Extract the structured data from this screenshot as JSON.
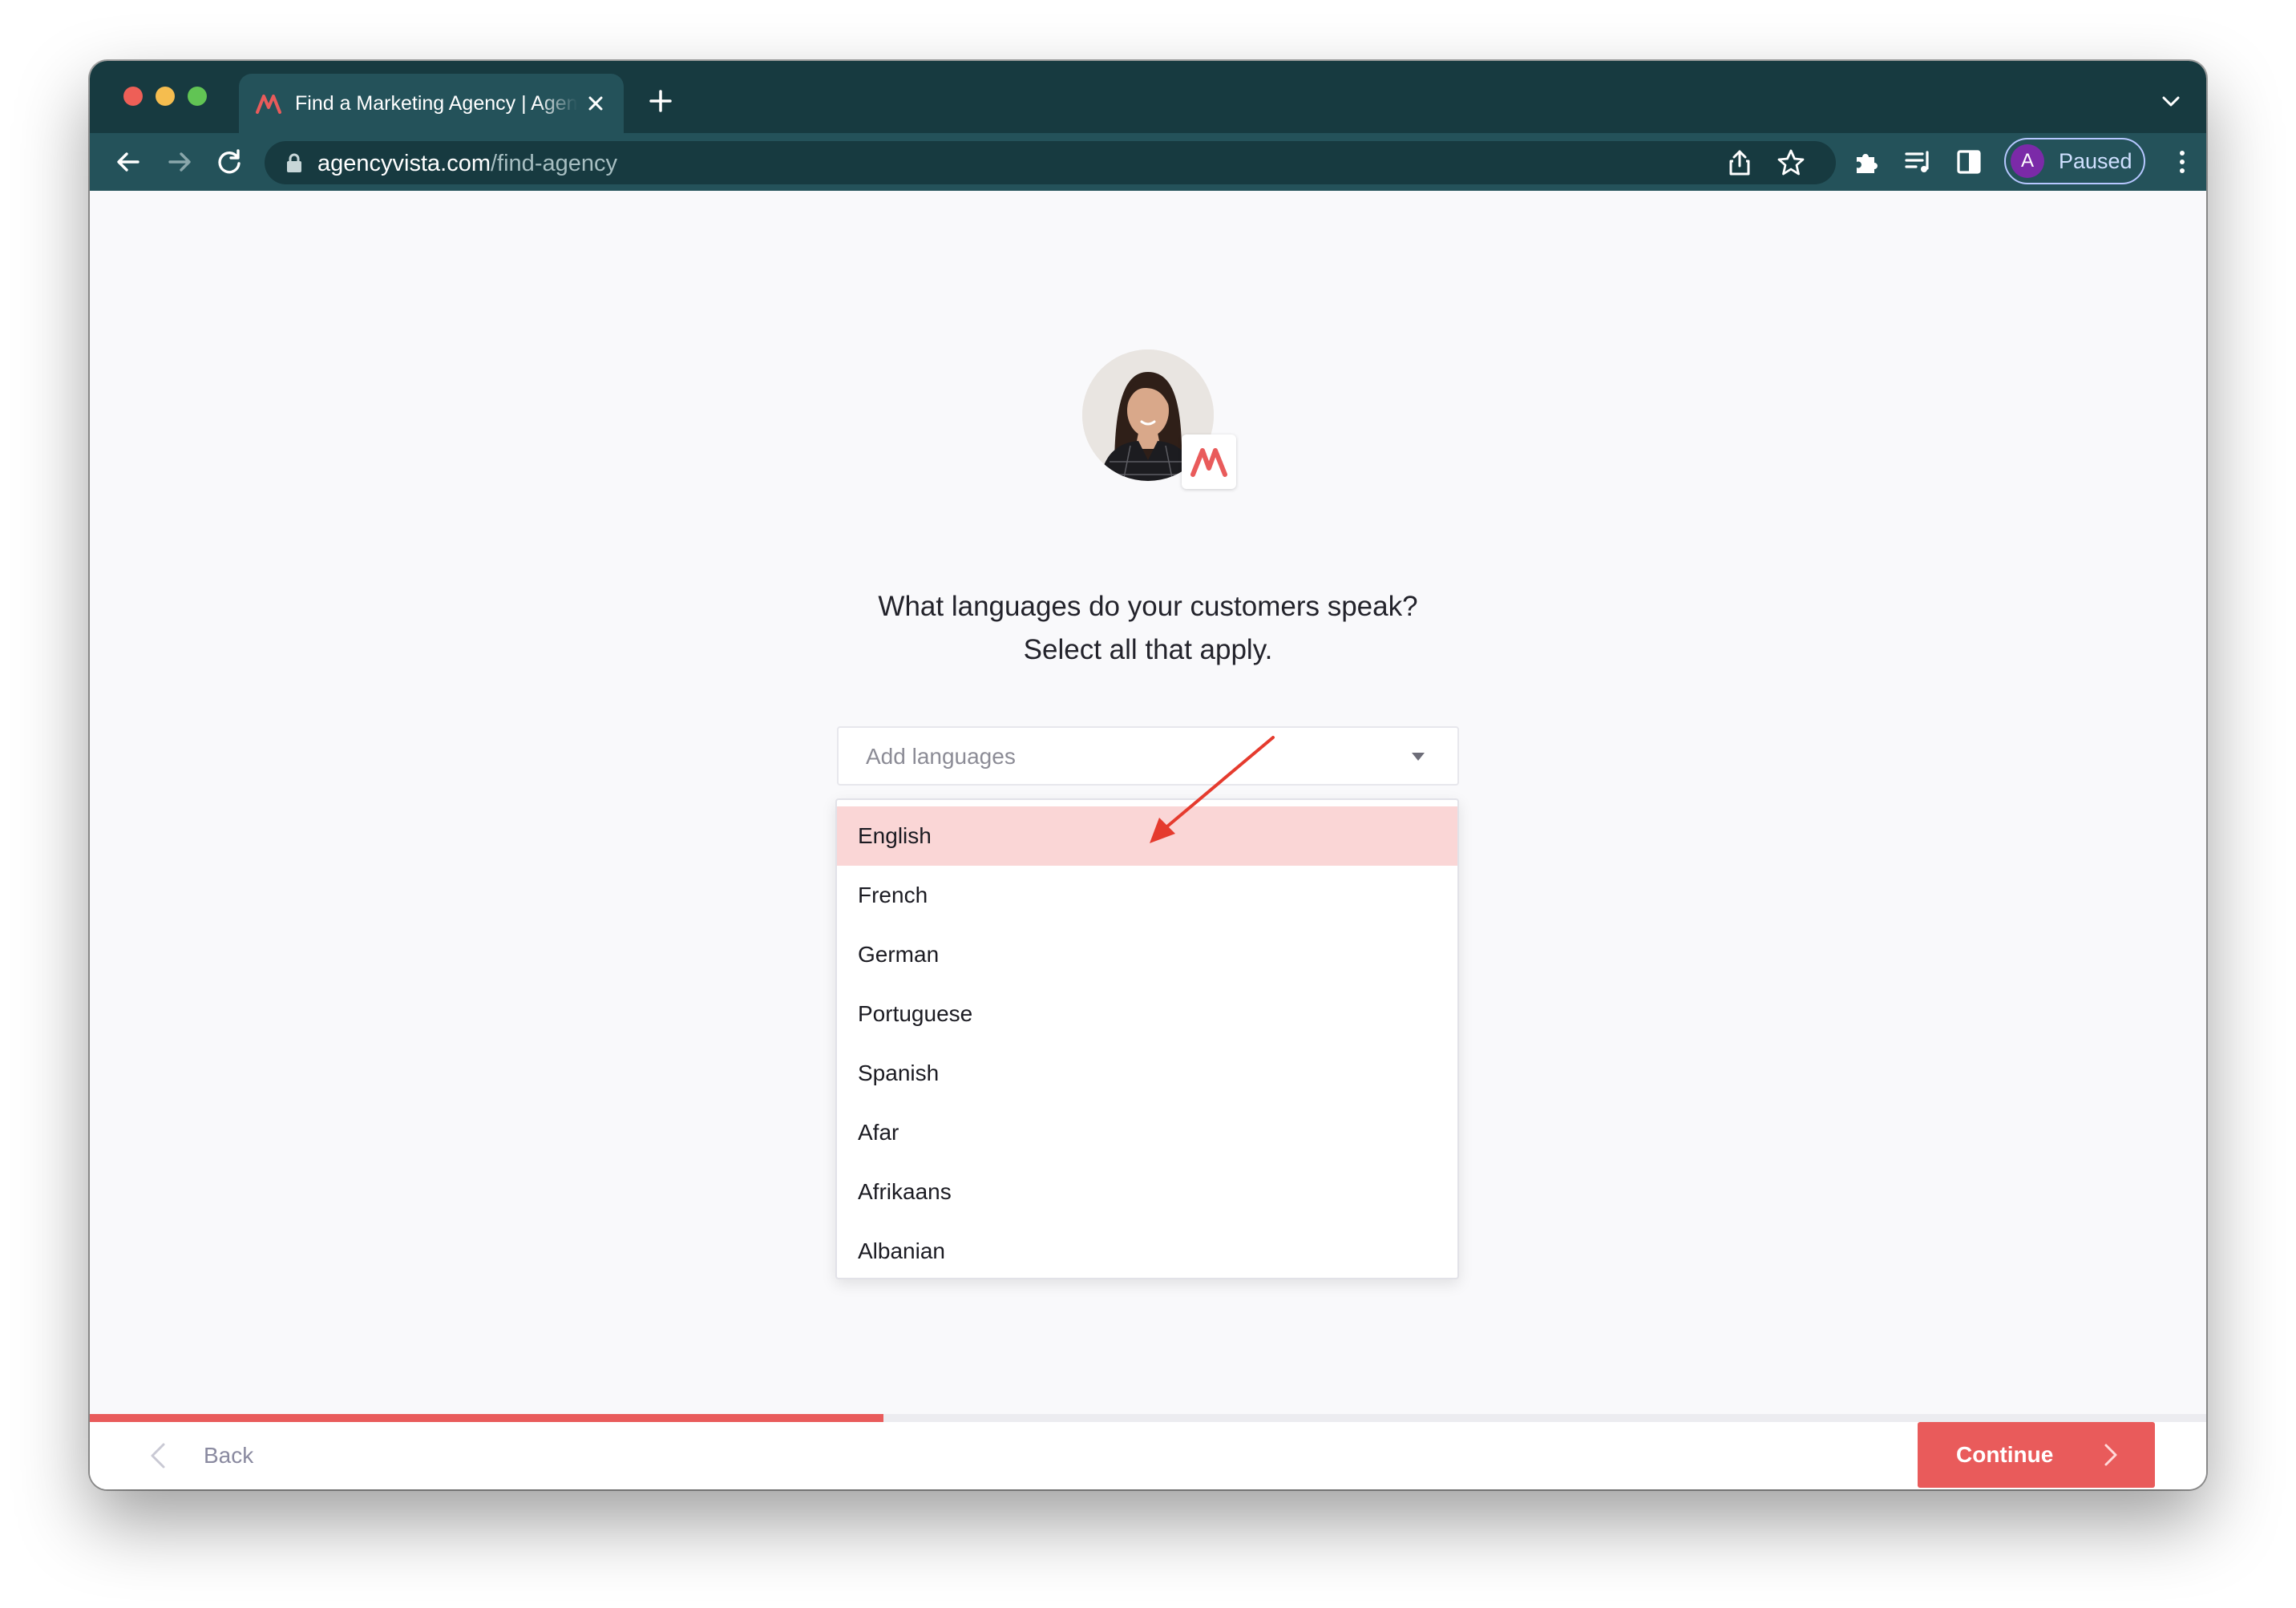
{
  "browser": {
    "tab_title": "Find a Marketing Agency | Agency Vista",
    "url_host": "agencyvista.com",
    "url_path": "/find-agency",
    "profile_initial": "A",
    "profile_status": "Paused",
    "colors": {
      "frame": "#173a40",
      "toolbar": "#24525a",
      "profile_avatar": "#7b2aa8"
    }
  },
  "page": {
    "question_line1": "What languages do your customers speak?",
    "question_line2": "Select all that apply.",
    "select": {
      "placeholder": "Add languages"
    },
    "languages": [
      "English",
      "French",
      "German",
      "Portuguese",
      "Spanish",
      "Afar",
      "Afrikaans",
      "Albanian"
    ],
    "highlighted_language": "English",
    "progress_fraction": 0.375,
    "accent_color": "#e95b5b",
    "highlight_color": "#fad6d6"
  },
  "footer": {
    "back_label": "Back",
    "continue_label": "Continue"
  }
}
